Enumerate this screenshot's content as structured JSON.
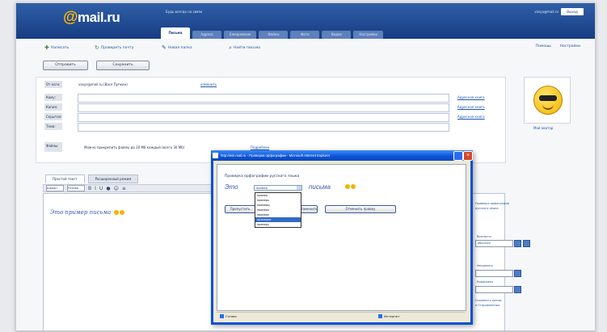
{
  "header": {
    "logo_text": "mail.ru",
    "logo_at": "@",
    "slogan": "Будь всегда на связи",
    "user_email": "vasya@mail.ru",
    "exit_label": "Выход",
    "tabs": [
      "Письма",
      "Адреса",
      "Ежедневник",
      "Файлы",
      "Фото",
      "Видео",
      "Настройки"
    ],
    "active_tab_index": 0
  },
  "toolbar": {
    "compose": "Написать",
    "check_mail": "Проверить почту",
    "new_folder": "Новая папка",
    "search": "Найти письмо",
    "help": "Помощь",
    "settings": "Настройки"
  },
  "actions": {
    "send": "Отправить",
    "save_draft": "Сохранить"
  },
  "form": {
    "from_label": "От кого:",
    "from_value": "vasya@mail.ru (Вася Пупкин)",
    "from_edit": "изменить",
    "to_label": "Кому:",
    "cc_label": "Копия:",
    "bcc_label": "Скрытая:",
    "subject_label": "Тема:",
    "to_link": "Адресная книга",
    "cc_link": "Адресная книга",
    "bcc_link": "Адресная книга",
    "attach_label": "Файлы:",
    "attach_text": "Можно прикрепить файлы до 20 Мб каждый (всего 30 Мб)",
    "attach_link": "Подробнее"
  },
  "avatar": {
    "caption": "Мой аватар"
  },
  "editor": {
    "tab_plain": "Простой текст",
    "tab_rich": "Расширенный режим",
    "font_select": "Шрифт",
    "size_select": "Размер",
    "body_text": "Это пример письма"
  },
  "sidebar": {
    "hint_line1": "Проверка орфографии",
    "hint_line2": "русского языка",
    "priority_label": "Важность",
    "priority_value": "обычная",
    "notify_label": "Уведомить",
    "encoding_label": "Кодировка",
    "save_copy": "Сохранить копию",
    "in_sent": "в Отправленных"
  },
  "dialog": {
    "title": "http://win.mail.ru - Проверка орфографии - Microsoft Internet Explorer",
    "heading": "Проверка орфографии русского языка",
    "text_before": "Это",
    "text_after": "письма",
    "select_value": "пример",
    "suggestions": [
      "пример",
      "примерь",
      "примеры",
      "примера",
      "примере",
      "примером",
      "примеру"
    ],
    "selected_index": 5,
    "button_ignore": "Пропустить",
    "button_replace": "Заменить",
    "button_close": "Отменить правку",
    "status_done": "Готово",
    "status_zone": "Интернет"
  }
}
